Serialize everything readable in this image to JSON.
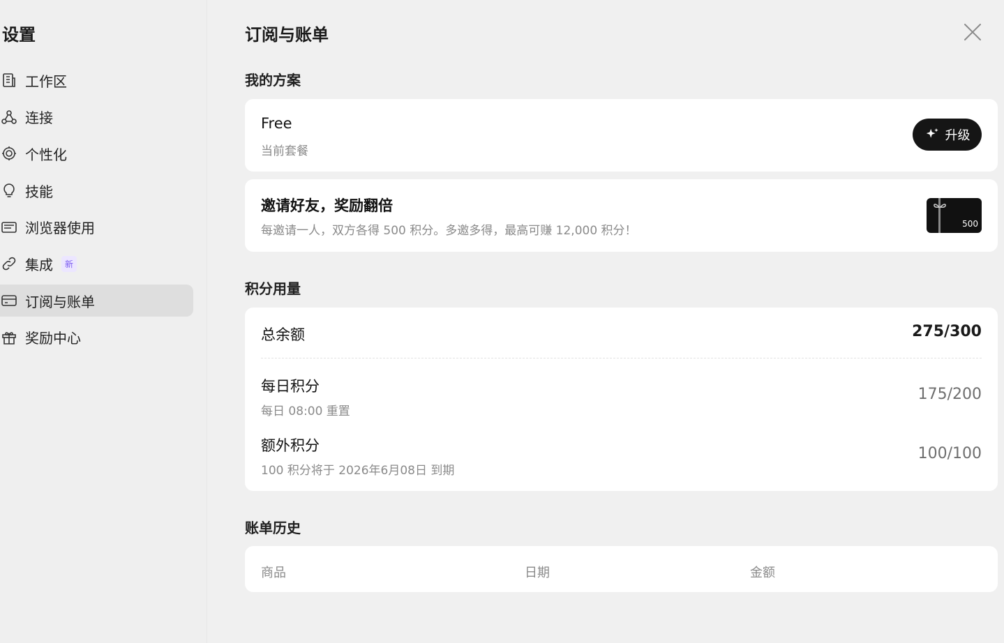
{
  "sidebar": {
    "title": "设置",
    "items": [
      {
        "label": "工作区",
        "icon": "building-icon"
      },
      {
        "label": "连接",
        "icon": "connections-icon"
      },
      {
        "label": "个性化",
        "icon": "personalize-icon"
      },
      {
        "label": "技能",
        "icon": "lightbulb-icon"
      },
      {
        "label": "浏览器使用",
        "icon": "browser-icon"
      },
      {
        "label": "集成",
        "icon": "link-icon",
        "badge": "新"
      },
      {
        "label": "订阅与账单",
        "icon": "card-icon",
        "active": true
      },
      {
        "label": "奖励中心",
        "icon": "gift-icon"
      }
    ]
  },
  "main": {
    "title": "订阅与账单",
    "my_plan": {
      "section_title": "我的方案",
      "plan_name": "Free",
      "plan_sub": "当前套餐",
      "upgrade_label": "升级"
    },
    "invite": {
      "title": "邀请好友，奖励翻倍",
      "sub": "每邀请一人，双方各得 500 积分。多邀多得，最高可赚 12,000 积分！",
      "gift_amount": "500"
    },
    "credits": {
      "section_title": "积分用量",
      "total_label": "总余额",
      "total_value": "275/300",
      "daily_label": "每日积分",
      "daily_sub": "每日 08:00 重置",
      "daily_value": "175/200",
      "extra_label": "额外积分",
      "extra_sub": "100 积分将于 2026年6月08日 到期",
      "extra_value": "100/100"
    },
    "billing": {
      "section_title": "账单历史",
      "columns": [
        "商品",
        "日期",
        "金额"
      ]
    }
  },
  "colors": {
    "background": "#f0f0f0",
    "card": "#ffffff",
    "active_nav": "#dedede",
    "upgrade_button": "#151515",
    "badge_text": "#7b5cf0",
    "badge_bg": "#ece6ff"
  }
}
